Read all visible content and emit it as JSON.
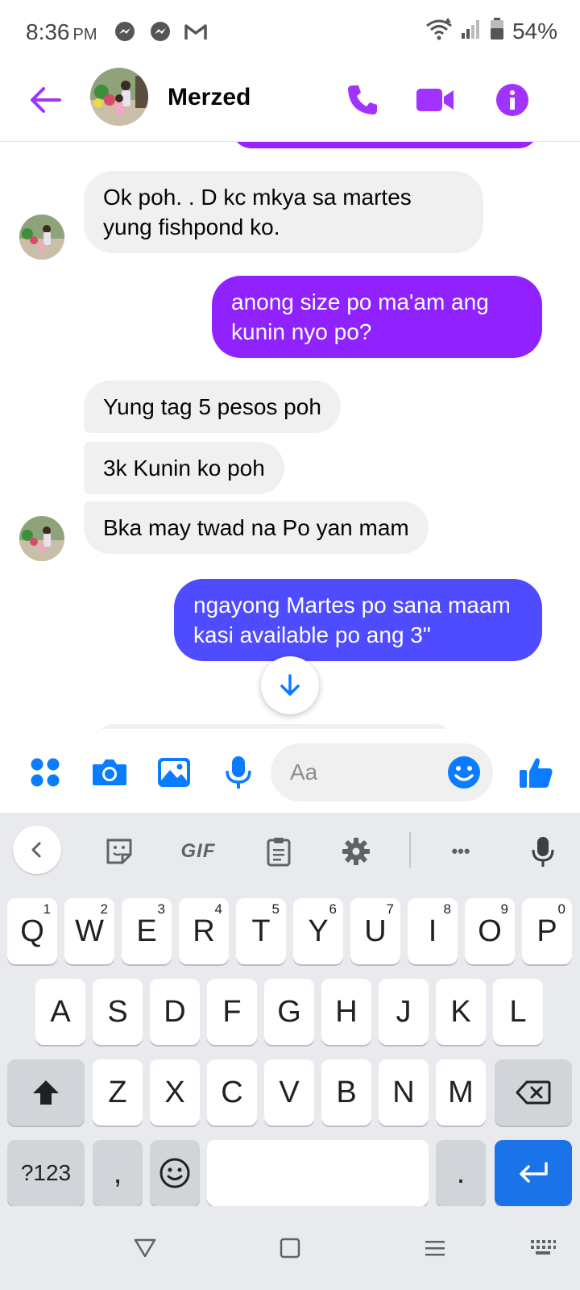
{
  "status_bar": {
    "time": "8:36",
    "ampm": "PM",
    "battery": "54%"
  },
  "header": {
    "contact_name": "Merzed"
  },
  "messages": [
    {
      "from": "me",
      "text": ""
    },
    {
      "from": "them",
      "text": "Ok poh. . D kc mkya sa martes yung fishpond ko."
    },
    {
      "from": "me",
      "text": "anong size po ma'am ang kunin nyo po?"
    },
    {
      "from": "them",
      "text": "Yung tag 5 pesos poh"
    },
    {
      "from": "them",
      "text": "3k Kunin ko poh"
    },
    {
      "from": "them",
      "text": "Bka may twad na Po yan mam"
    },
    {
      "from": "me",
      "text": "ngayong Martes po sana maam kasi available po ang 3\""
    }
  ],
  "composer": {
    "placeholder": "Aa"
  },
  "keyboard": {
    "toolbar": {
      "gif": "GIF",
      "more": "•••"
    },
    "row1": [
      {
        "k": "Q",
        "h": "1"
      },
      {
        "k": "W",
        "h": "2"
      },
      {
        "k": "E",
        "h": "3"
      },
      {
        "k": "R",
        "h": "4"
      },
      {
        "k": "T",
        "h": "5"
      },
      {
        "k": "Y",
        "h": "6"
      },
      {
        "k": "U",
        "h": "7"
      },
      {
        "k": "I",
        "h": "8"
      },
      {
        "k": "O",
        "h": "9"
      },
      {
        "k": "P",
        "h": "0"
      }
    ],
    "row2": [
      "A",
      "S",
      "D",
      "F",
      "G",
      "H",
      "J",
      "K",
      "L"
    ],
    "row3": [
      "Z",
      "X",
      "C",
      "V",
      "B",
      "N",
      "M"
    ],
    "symbols_label": "?123",
    "comma": ",",
    "period": "."
  },
  "colors": {
    "accent": "#a033ff",
    "outgoing_gradient_top": "#9b1fff",
    "outgoing_gradient_bottom": "#4f4bff",
    "incoming_bg": "#f0f0f0",
    "composer_blue": "#0a7cff",
    "keyboard_bg": "#e8eaed",
    "enter_key": "#1a73e8"
  }
}
